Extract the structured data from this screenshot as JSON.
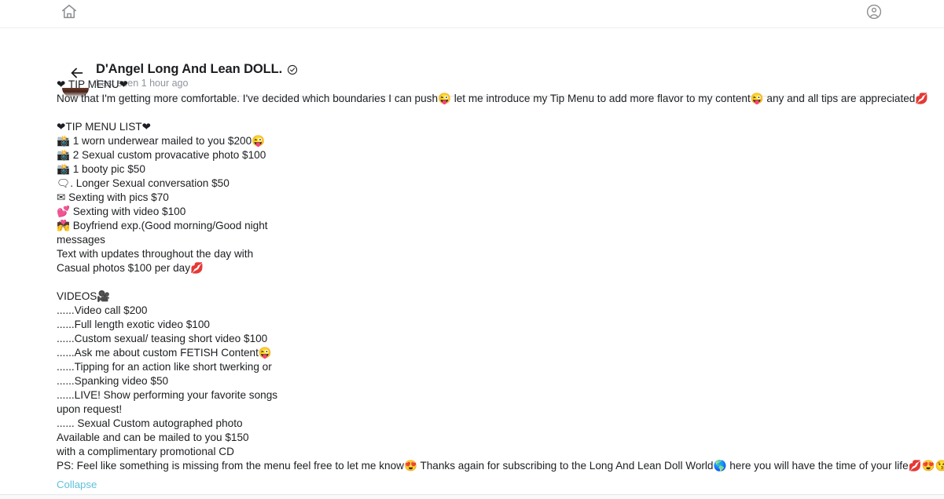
{
  "app_bar": {
    "home_icon": "home-icon",
    "account_icon": "account-avatar-icon"
  },
  "conversation": {
    "back_icon": "back-arrow-icon",
    "title": "D'Angel Long And Lean DOLL.",
    "verified_icon": "verified-badge-icon",
    "subtitle": "Last seen 1 hour ago",
    "avatar": "contact-avatar"
  },
  "message": {
    "lines": [
      {
        "text": "❤ TIP MENU❤"
      },
      {
        "text": "Now that I'm getting more comfortable. I've decided which boundaries I can push😜 let me introduce my Tip Menu to add more flavor to my content😜 any and all tips are appreciated💋"
      },
      {
        "text": ""
      },
      {
        "text": "❤TIP MENU LIST❤"
      },
      {
        "text": "📸 1 worn underwear mailed to you $200😜"
      },
      {
        "text": "📸 2 Sexual custom provacative photo $100"
      },
      {
        "text": "📸 1 booty pic $50"
      },
      {
        "text": "🗨. Longer Sexual conversation $50"
      },
      {
        "text": "✉ Sexting with pics $70"
      },
      {
        "text": "💕 Sexting with video $100"
      },
      {
        "text": "💏 Boyfriend exp.(Good morning/Good night"
      },
      {
        "text": "messages"
      },
      {
        "text": "Text with updates throughout the day with"
      },
      {
        "text": "Casual photos $100 per day💋"
      },
      {
        "text": ""
      },
      {
        "text": "VIDEOS🎥"
      },
      {
        "text": "......Video call $200"
      },
      {
        "text": "......Full length exotic video $100"
      },
      {
        "text": "......Custom sexual/ teasing short video $100"
      },
      {
        "text": "......Ask me about custom FETISH Content😜"
      },
      {
        "text": "......Tipping for an action like short twerking or"
      },
      {
        "text": "......Spanking video $50"
      },
      {
        "text": "......LIVE! Show performing your favorite songs"
      },
      {
        "text": "upon request!"
      },
      {
        "text": "...... Sexual Custom autographed photo"
      },
      {
        "text": "Available and can be mailed to you $150"
      },
      {
        "text": "with a complimentary promotional CD"
      },
      {
        "text": "PS: Feel like something is missing from the menu feel free to let me know😍 Thanks again for subscribing to the Long And Lean Doll World🌎 here you will have the time of your life💋😍😘"
      }
    ]
  },
  "footer": {
    "collapse_label": "Collapse"
  },
  "colors": {
    "link": "#5ec1dd",
    "text": "#1c1e21",
    "muted": "#90949c",
    "divider": "#e6e6e6"
  }
}
